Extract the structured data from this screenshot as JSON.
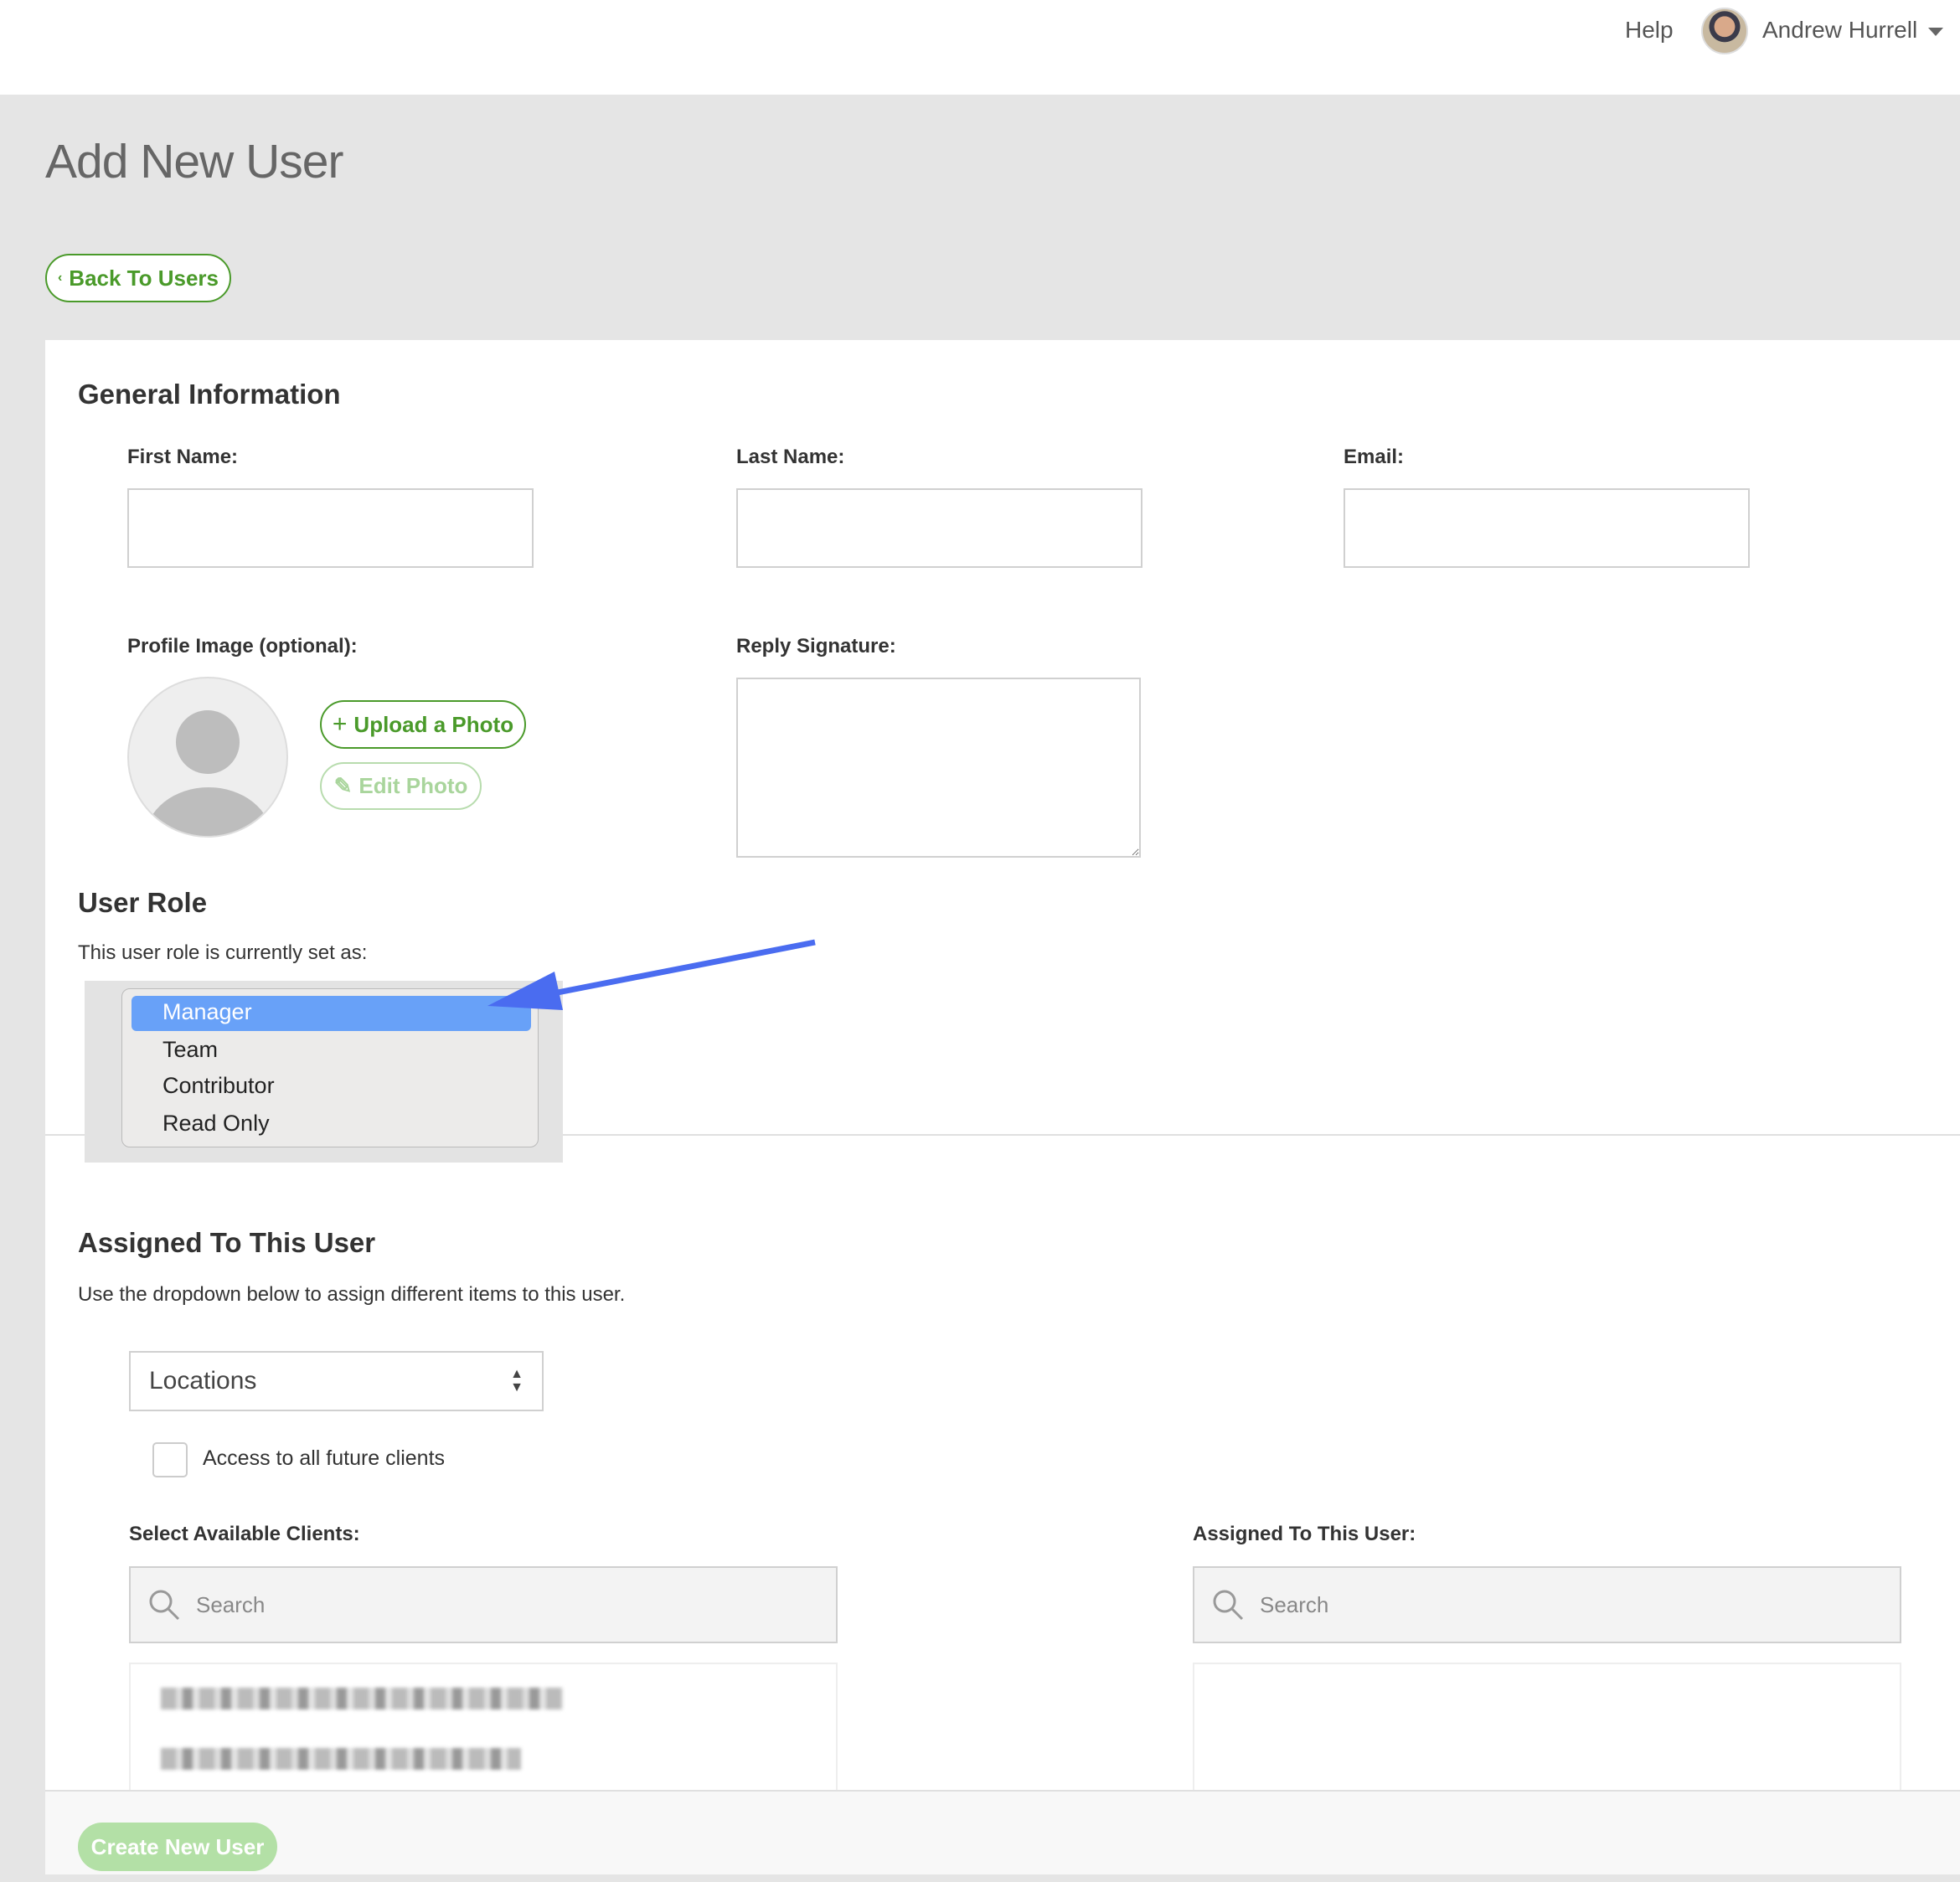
{
  "topbar": {
    "help": "Help",
    "user_name": "Andrew Hurrell"
  },
  "page": {
    "title": "Add New User",
    "back_button": "Back To Users"
  },
  "general": {
    "heading": "General Information",
    "first_name_label": "First Name:",
    "first_name_value": "",
    "last_name_label": "Last Name:",
    "last_name_value": "",
    "email_label": "Email:",
    "email_value": "",
    "profile_label": "Profile Image (optional):",
    "upload_button": "Upload a Photo",
    "edit_button": "Edit Photo",
    "signature_label": "Reply Signature:",
    "signature_value": ""
  },
  "role": {
    "heading": "User Role",
    "subtext": "This user role is currently set as:",
    "options": [
      "Manager",
      "Team",
      "Contributor",
      "Read Only"
    ],
    "selected": "Manager",
    "highlight_color": "#68a1f8",
    "arrow_color": "#4a6cf0"
  },
  "assigned": {
    "heading": "Assigned To This User",
    "subtext": "Use the dropdown below to assign different items to this user.",
    "dropdown_value": "Locations",
    "checkbox_label": "Access to all future clients",
    "checkbox_checked": false,
    "available_label": "Select Available Clients:",
    "assigned_label": "Assigned To This User:",
    "search_placeholder": "Search"
  },
  "footer": {
    "create_button": "Create New User"
  },
  "colors": {
    "accent": "#4a9a2a",
    "background": "#e5e5e5"
  }
}
